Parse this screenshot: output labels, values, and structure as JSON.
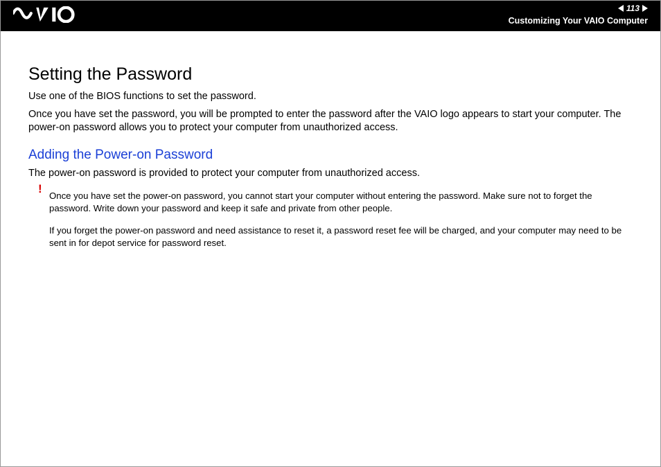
{
  "header": {
    "page_number": "113",
    "section": "Customizing Your VAIO Computer"
  },
  "content": {
    "heading": "Setting the Password",
    "intro1": "Use one of the BIOS functions to set the password.",
    "intro2": "Once you have set the password, you will be prompted to enter the password after the VAIO logo appears to start your computer. The power-on password allows you to protect your computer from unauthorized access.",
    "subheading": "Adding the Power-on Password",
    "sub_intro": "The power-on password is provided to protect your computer from unauthorized access.",
    "warn_icon": "!",
    "warn1": "Once you have set the power-on password, you cannot start your computer without entering the password. Make sure not to forget the password. Write down your password and keep it safe and private from other people.",
    "warn2": "If you forget the power-on password and need assistance to reset it, a password reset fee will be charged, and your computer may need to be sent in for depot service for password reset."
  }
}
